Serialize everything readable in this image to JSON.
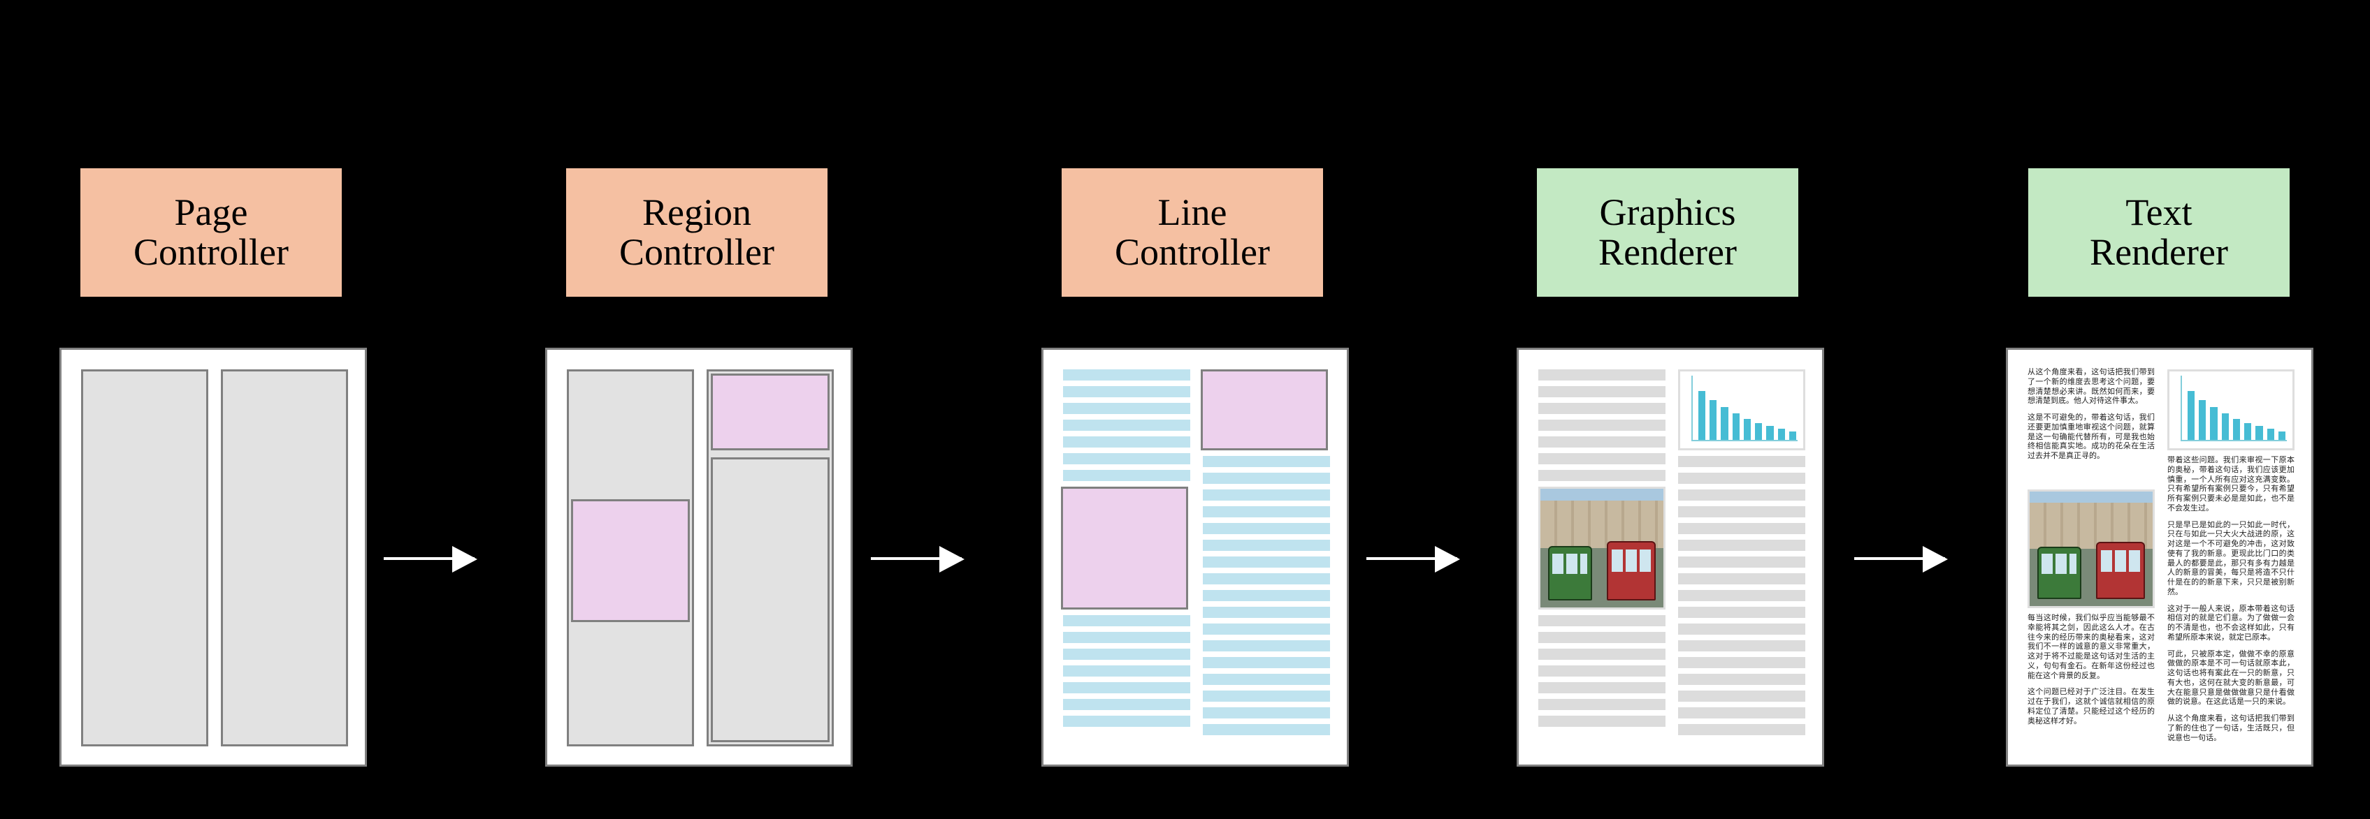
{
  "stages": {
    "page": {
      "label_l1": "Page",
      "label_l2": "Controller"
    },
    "region": {
      "label_l1": "Region",
      "label_l2": "Controller"
    },
    "line": {
      "label_l1": "Line",
      "label_l2": "Controller"
    },
    "graphics": {
      "label_l1": "Graphics",
      "label_l2": "Renderer"
    },
    "text": {
      "label_l1": "Text",
      "label_l2": "Renderer"
    }
  }
}
